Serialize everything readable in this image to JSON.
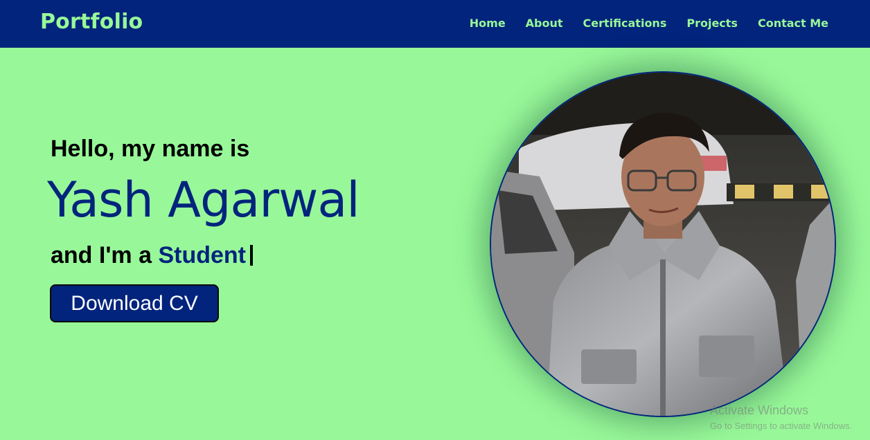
{
  "navbar": {
    "brand": "Portfolio",
    "links": [
      "Home",
      "About",
      "Certifications",
      "Projects",
      "Contact Me"
    ]
  },
  "hero": {
    "greeting": "Hello, my name is",
    "name": "Yash Agarwal",
    "role_prefix": "and I'm a",
    "role": "Student",
    "cv_button": "Download CV"
  },
  "watermark": {
    "title": "Activate Windows",
    "subtitle": "Go to Settings to activate Windows."
  },
  "colors": {
    "background": "#98f899",
    "navbar": "#02247c",
    "accent": "#02247c",
    "nav_text": "#98f899"
  },
  "icons": {
    "profile_photo": "person-photo"
  }
}
